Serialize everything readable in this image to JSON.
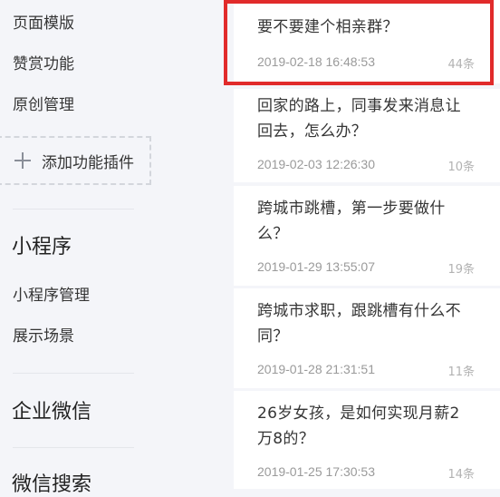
{
  "sidebar": {
    "links": [
      "页面模版",
      "赞赏功能",
      "原创管理"
    ],
    "add_plugin": "添加功能插件",
    "mini_program": {
      "title": "小程序",
      "items": [
        "小程序管理",
        "展示场景"
      ]
    },
    "wecom_title": "企业微信",
    "search_title": "微信搜索"
  },
  "articles": [
    {
      "title": "要不要建个相亲群？",
      "date": "2019-02-18 16:48:53",
      "count": "44条",
      "highlighted": true
    },
    {
      "title": "回家的路上，同事发来消息让回去，怎么办？",
      "date": "2019-02-03 12:26:30",
      "count": "10条"
    },
    {
      "title": "跨城市跳槽，第一步要做什么？",
      "date": "2019-01-29 13:55:07",
      "count": "19条"
    },
    {
      "title": "跨城市求职，跟跳槽有什么不同？",
      "date": "2019-01-28 21:31:51",
      "count": "11条"
    },
    {
      "title": "26岁女孩，是如何实现月薪2万8的？",
      "date": "2019-01-25 17:30:53",
      "count": "14条"
    }
  ],
  "colors": {
    "highlight_border": "#e12b2b",
    "background": "#f4f5f9",
    "card": "#ffffff"
  }
}
